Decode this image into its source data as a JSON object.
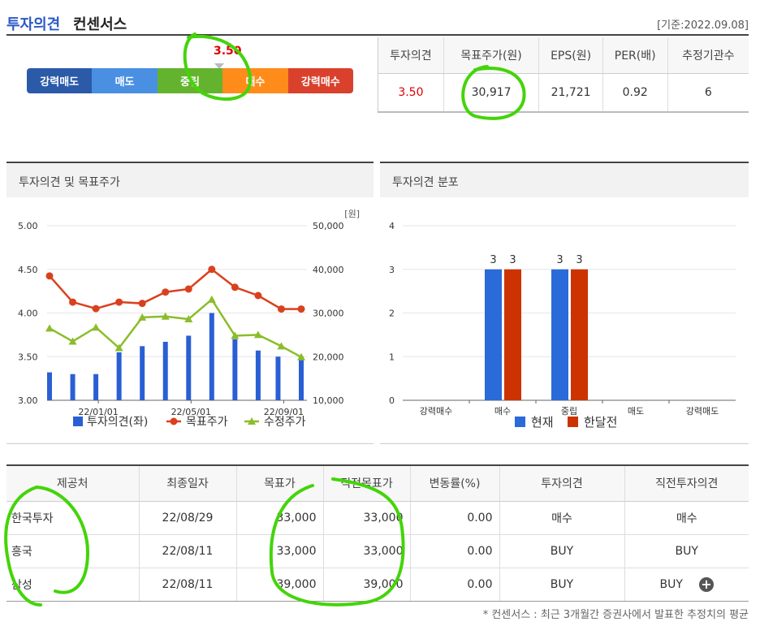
{
  "header": {
    "title_blue": "투자의견",
    "title_rest": "컨센서스",
    "date": "[기준:2022.09.08]"
  },
  "opinion_bar": {
    "value": "3.50",
    "segments": [
      "강력매도",
      "매도",
      "중립",
      "매수",
      "강력매수"
    ]
  },
  "summary": {
    "headers": [
      "투자의견",
      "목표주가(원)",
      "EPS(원)",
      "PER(배)",
      "추정기관수"
    ],
    "values": [
      "3.50",
      "30,917",
      "21,721",
      "0.92",
      "6"
    ]
  },
  "panel1": {
    "title": "투자의견 및 목표주가",
    "unit": "[원]"
  },
  "panel2": {
    "title": "투자의견 분포"
  },
  "chart_data": [
    {
      "type": "bar+line",
      "title": "투자의견 및 목표주가",
      "y_left": {
        "lim": [
          3.0,
          5.0
        ],
        "ticks": [
          "3.00",
          "3.50",
          "4.00",
          "4.50",
          "5.00"
        ]
      },
      "y_right": {
        "lim": [
          10000,
          50000
        ],
        "ticks": [
          "10,000",
          "20,000",
          "30,000",
          "40,000",
          "50,000"
        ],
        "unit": "[원]"
      },
      "x_ticks": [
        "22/01/01",
        "22/05/01",
        "22/09/01"
      ],
      "series": [
        {
          "name": "투자의견(좌)",
          "kind": "bar",
          "color": "#2a5fd4",
          "values": [
            3.32,
            3.3,
            3.3,
            3.55,
            3.62,
            3.67,
            3.74,
            4.0,
            3.7,
            3.57,
            3.5,
            3.5
          ]
        },
        {
          "name": "목표주가",
          "kind": "line",
          "marker": "circle",
          "color": "#d9411e",
          "values": [
            38500,
            32500,
            31000,
            32500,
            32200,
            34800,
            35500,
            40000,
            35900,
            34000,
            30917,
            30917
          ]
        },
        {
          "name": "수정주가",
          "kind": "line",
          "marker": "triangle",
          "color": "#8bbd2a",
          "values": [
            26500,
            23500,
            26700,
            22000,
            29000,
            29200,
            28600,
            33100,
            24800,
            25000,
            22400,
            19900
          ]
        }
      ]
    },
    {
      "type": "bar",
      "title": "투자의견 분포",
      "categories": [
        "강력매수",
        "매수",
        "중립",
        "매도",
        "강력매도"
      ],
      "ylim": [
        0,
        4
      ],
      "y_ticks": [
        "0",
        "1",
        "2",
        "3",
        "4"
      ],
      "series": [
        {
          "name": "현재",
          "color": "#2a6ad9",
          "values": [
            0,
            3,
            3,
            0,
            0
          ]
        },
        {
          "name": "한달전",
          "color": "#cc3300",
          "values": [
            0,
            3,
            3,
            0,
            0
          ]
        }
      ]
    }
  ],
  "table": {
    "headers": [
      "제공처",
      "최종일자",
      "목표가",
      "직전목표가",
      "변동률(%)",
      "투자의견",
      "직전투자의견"
    ],
    "rows": [
      [
        "한국투자",
        "22/08/29",
        "33,000",
        "33,000",
        "0.00",
        "매수",
        "매수"
      ],
      [
        "흥국",
        "22/08/11",
        "33,000",
        "33,000",
        "0.00",
        "BUY",
        "BUY"
      ],
      [
        "삼성",
        "22/08/11",
        "39,000",
        "39,000",
        "0.00",
        "BUY",
        "BUY"
      ]
    ],
    "plus_symbol": "+"
  },
  "footnote": "* 컨센서스 : 최근 3개월간 증권사에서 발표한 추정치의 평균"
}
